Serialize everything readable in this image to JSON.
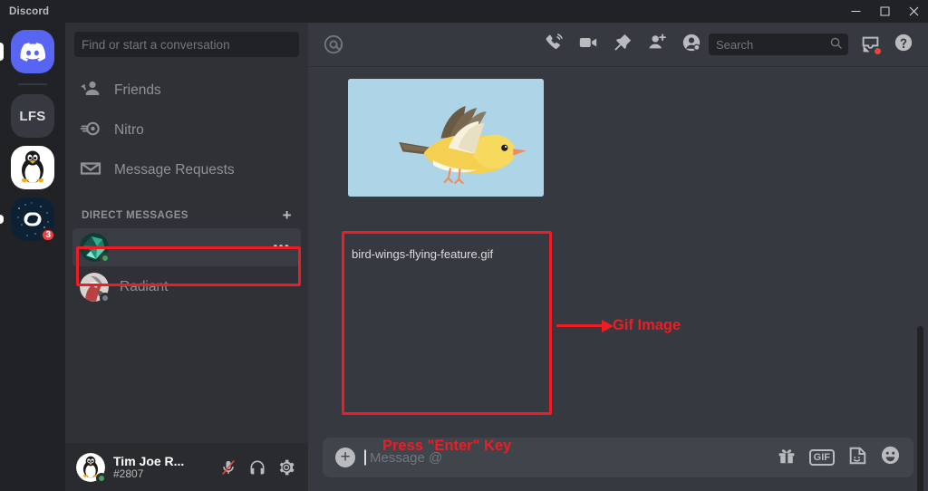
{
  "window": {
    "title": "Discord",
    "minimize_label": "Minimize",
    "maximize_label": "Maximize",
    "close_label": "Close"
  },
  "server_rail": {
    "items": [
      {
        "name": "Direct Messages",
        "type": "home",
        "icon": "discord-logo-icon",
        "badge": "",
        "selected": true
      },
      {
        "name": "LFS",
        "type": "text",
        "label": "LFS",
        "badge": ""
      },
      {
        "name": "Linux Server",
        "type": "tux",
        "icon": "penguin-avatar-icon",
        "badge": ""
      },
      {
        "name": "Space Server",
        "type": "space",
        "icon": "links-logo-icon",
        "badge": "3"
      }
    ]
  },
  "sidebar": {
    "search_placeholder": "Find or start a conversation",
    "nav": [
      {
        "label": "Friends",
        "icon": "friends-icon"
      },
      {
        "label": "Nitro",
        "icon": "nitro-icon"
      },
      {
        "label": "Message Requests",
        "icon": "envelope-icon"
      }
    ],
    "dm_header": "DIRECT MESSAGES",
    "dm_add_label": "+",
    "dms": [
      {
        "label": "",
        "status": "online",
        "active": true,
        "more": "•••"
      },
      {
        "label": "Radiant",
        "status": "offline",
        "active": false,
        "more": ""
      }
    ]
  },
  "user_panel": {
    "name": "Tim Joe R...",
    "tag": "#2807",
    "status": "online",
    "icons": [
      {
        "name": "microphone-muted-icon"
      },
      {
        "name": "headphones-icon"
      },
      {
        "name": "settings-gear-icon"
      }
    ]
  },
  "chat_header": {
    "at_icon": "mention-at-icon",
    "icons": [
      {
        "name": "voice-call-icon"
      },
      {
        "name": "video-call-icon"
      },
      {
        "name": "pinned-messages-icon"
      },
      {
        "name": "add-friend-icon"
      },
      {
        "name": "user-profile-icon"
      }
    ],
    "search_placeholder": "Search",
    "right_icons": [
      {
        "name": "inbox-icon",
        "has_dot": true
      },
      {
        "name": "help-icon"
      }
    ]
  },
  "message": {
    "attachment": {
      "filename": "bird-wings-flying-feature.gif",
      "background_color": "#aed4e8",
      "alt": "yellow bird flying with brown wings"
    }
  },
  "composer": {
    "plus_label": "+",
    "placeholder": "Message @",
    "icons": [
      {
        "name": "gift-icon"
      },
      {
        "name": "gif-icon",
        "label": "GIF"
      },
      {
        "name": "sticker-icon"
      },
      {
        "name": "emoji-icon"
      }
    ]
  },
  "annotations": {
    "gif_image_label": "Gif Image",
    "press_enter_label": "Press \"Enter\" Key",
    "highlight_color": "#ee1c24"
  }
}
